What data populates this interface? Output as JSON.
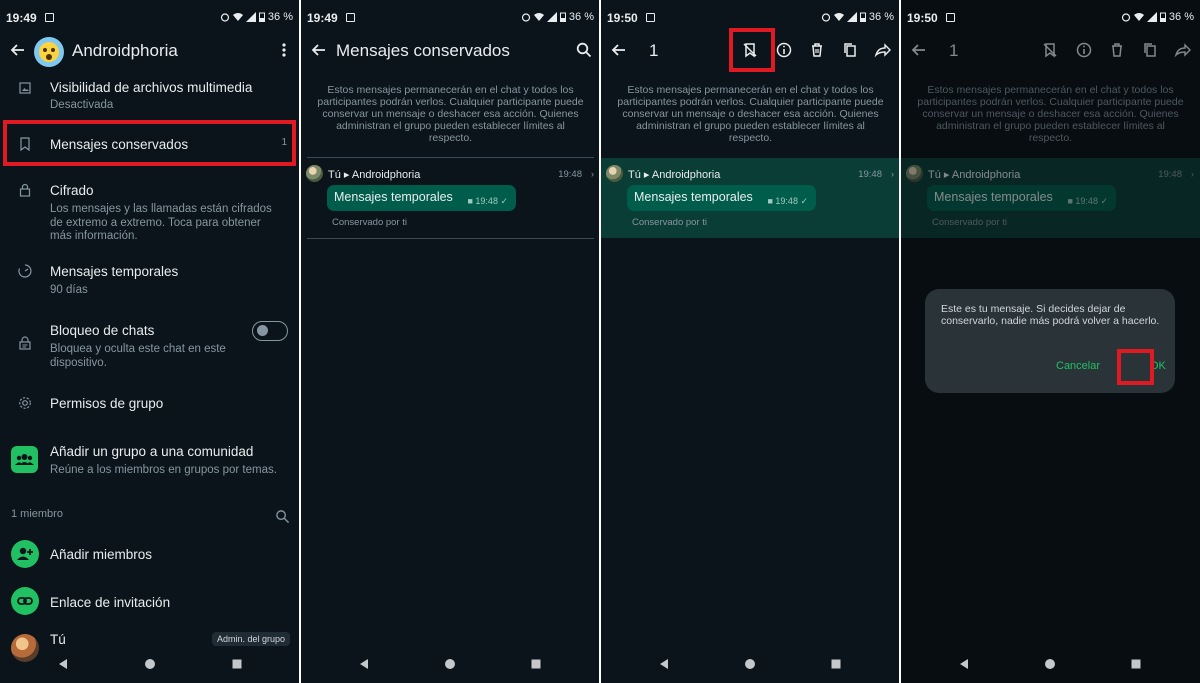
{
  "status_bar": {
    "time_1": "19:49",
    "time_2": "19:49",
    "time_3": "19:50",
    "time_4": "19:50",
    "battery": "36 %"
  },
  "screen1": {
    "group_name": "Androidphoria",
    "items": [
      {
        "title": "Visibilidad de archivos multimedia",
        "subtitle": "Desactivada"
      },
      {
        "title": "Mensajes conservados",
        "count": "1"
      },
      {
        "title": "Cifrado",
        "subtitle": "Los mensajes y las llamadas están cifrados de extremo a extremo. Toca para obtener más información."
      },
      {
        "title": "Mensajes temporales",
        "subtitle": "90 días"
      },
      {
        "title": "Bloqueo de chats",
        "subtitle": "Bloquea y oculta este chat en este dispositivo."
      },
      {
        "title": "Permisos de grupo"
      },
      {
        "title": "Añadir un grupo a una comunidad",
        "subtitle": "Reúne a los miembros en grupos por temas."
      }
    ],
    "members_count": "1 miembro",
    "add_members": "Añadir miembros",
    "invite_link": "Enlace de invitación",
    "me": "Tú",
    "admin_badge": "Admin. del grupo"
  },
  "screen2": {
    "title": "Mensajes conservados"
  },
  "shared": {
    "info_text": "Estos mensajes permanecerán en el chat y todos los participantes podrán verlos. Cualquier participante puede conservar un mensaje o deshacer esa acción. Quienes administran el grupo pueden establecer límites al respecto.",
    "sender": "Tú",
    "chat_name": "Androidphoria",
    "message_time": "19:48",
    "message_text": "Mensajes temporales",
    "bubble_time": "19:48",
    "kept_by": "Conservado por ti",
    "selected_count": "1"
  },
  "dialog": {
    "text": "Este es tu mensaje. Si decides dejar de conservarlo, nadie más podrá volver a hacerlo.",
    "cancel": "Cancelar",
    "ok": "OK"
  },
  "colors": {
    "background": "#0b141a",
    "bubble": "#005c4b",
    "accent_green": "#21c063",
    "highlight_red": "#e01a22",
    "selection": "#0a3d35"
  },
  "icons": [
    "back-arrow-icon",
    "more-vert-icon",
    "search-icon",
    "unkeep-icon",
    "info-icon",
    "delete-icon",
    "copy-icon",
    "forward-icon",
    "image-icon",
    "bookmark-icon",
    "lock-icon",
    "timer-icon",
    "chat-lock-icon",
    "gear-icon",
    "community-icon",
    "add-person-icon",
    "link-icon"
  ]
}
